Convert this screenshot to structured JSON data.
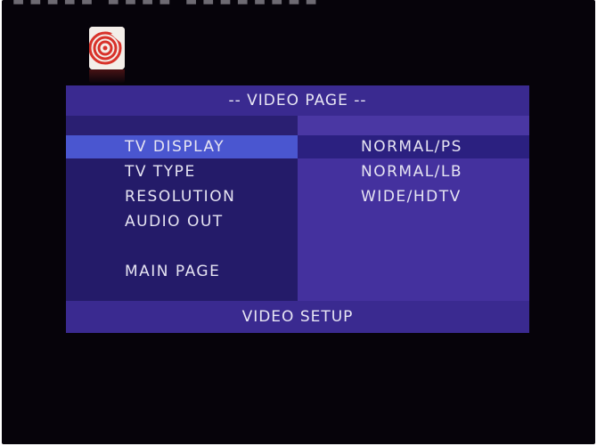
{
  "top_text": "■■■■■ ■■■■ ■■■■■■■■",
  "logo": {
    "icon": "disc-logo-icon",
    "colors": {
      "ring": "#d8322a",
      "background": "#f3eee9"
    }
  },
  "header": {
    "title": "-- VIDEO PAGE --"
  },
  "menu": {
    "items": [
      {
        "label": "TV DISPLAY",
        "selected": true
      },
      {
        "label": "TV TYPE",
        "selected": false
      },
      {
        "label": "RESOLUTION",
        "selected": false
      },
      {
        "label": "AUDIO OUT",
        "selected": false
      },
      {
        "label": "MAIN PAGE",
        "selected": false
      }
    ]
  },
  "options": {
    "items": [
      {
        "label": "NORMAL/PS"
      },
      {
        "label": "NORMAL/LB"
      },
      {
        "label": "WIDE/HDTV"
      }
    ]
  },
  "footer": {
    "status": "VIDEO SETUP"
  },
  "colors": {
    "screen_bg": "#06030a",
    "header_bg": "#3a2a90",
    "left_bg": "#241b69",
    "right_bg": "#44319e",
    "highlight": "#4a56d0",
    "text": "#e6e4f2"
  }
}
